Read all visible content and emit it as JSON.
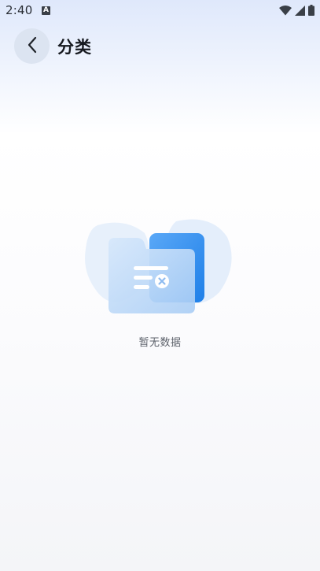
{
  "status_bar": {
    "time": "2:40",
    "notification_icon_letter": "A",
    "icons": [
      "wifi-icon",
      "signal-icon",
      "battery-icon"
    ]
  },
  "header": {
    "back_icon": "chevron-left-icon",
    "title": "分类"
  },
  "empty_state": {
    "illustration": "empty-folder-icon",
    "message": "暂无数据"
  },
  "colors": {
    "accent_blue": "#2d8cf0",
    "back_button_bg": "#dce4f1",
    "title_text": "#16191f",
    "empty_text": "#5d626b"
  }
}
